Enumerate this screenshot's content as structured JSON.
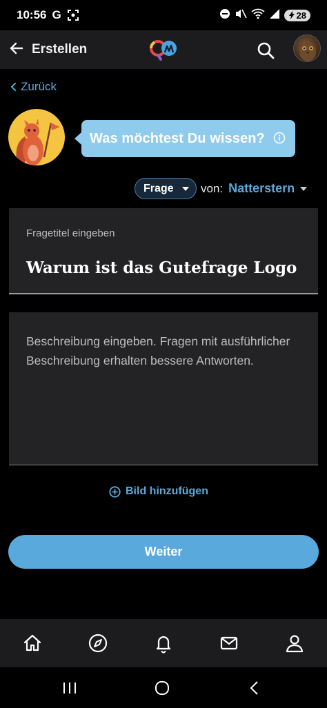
{
  "status": {
    "time": "10:56",
    "g": "G",
    "battery": "28"
  },
  "appbar": {
    "title": "Erstellen"
  },
  "back": {
    "label": "Zurück"
  },
  "bubble": {
    "text": "Was möchtest Du wissen?"
  },
  "type_selector": {
    "value": "Frage",
    "von_label": "von:",
    "author": "Natterstern"
  },
  "title_field": {
    "label": "Fragetitel eingeben",
    "value": "Warum ist das Gutefrage Logo"
  },
  "description": {
    "placeholder": "Beschreibung eingeben. Fragen mit ausführlicher Beschreibung erhalten bessere Antworten."
  },
  "add_image": {
    "label": "Bild hinzufügen"
  },
  "submit": {
    "label": "Weiter"
  },
  "colors": {
    "accent": "#5aa9dc",
    "bubble": "#8fcbec",
    "surface": "#232325",
    "bar": "#1c1c1e",
    "mascot_bg": "#f5c542"
  },
  "icons": [
    "back-arrow-icon",
    "search-icon",
    "info-icon",
    "plus-circle-icon",
    "home-icon",
    "compass-icon",
    "bell-icon",
    "mail-icon",
    "profile-icon"
  ]
}
